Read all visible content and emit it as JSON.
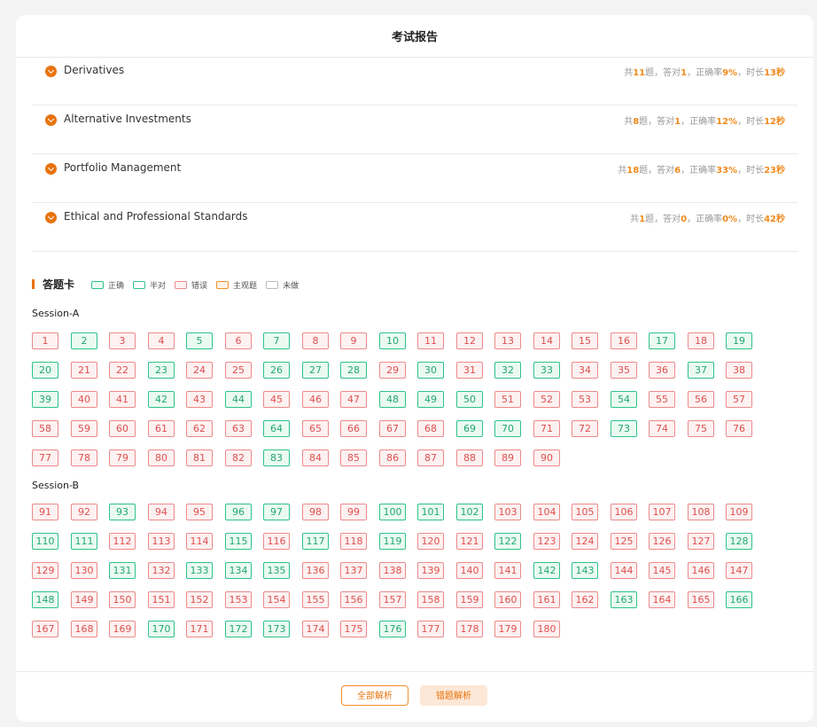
{
  "header": {
    "title": "考试报告"
  },
  "topics": [
    {
      "name": "Derivatives",
      "total": "11",
      "correct": "1",
      "rate": "9%",
      "duration": "13秒"
    },
    {
      "name": "Alternative Investments",
      "total": "8",
      "correct": "1",
      "rate": "12%",
      "duration": "12秒"
    },
    {
      "name": "Portfolio Management",
      "total": "18",
      "correct": "6",
      "rate": "33%",
      "duration": "23秒"
    },
    {
      "name": "Ethical and Professional Standards",
      "total": "1",
      "correct": "0",
      "rate": "0%",
      "duration": "42秒"
    }
  ],
  "stat_labels": {
    "total_prefix": "共",
    "total_suffix": "题，答对",
    "rate_prefix": "，正确率",
    "duration_prefix": "，时长"
  },
  "answer_card": {
    "title": "答题卡",
    "legend": [
      {
        "label": "正确",
        "border": "#2fc28a",
        "fill": "#eafaf3"
      },
      {
        "label": "半对",
        "border": "#2fc28a",
        "fill": "#ffffff"
      },
      {
        "label": "错误",
        "border": "#ec8a8a",
        "fill": "#fdf1f1"
      },
      {
        "label": "主观题",
        "border": "#f0902a",
        "fill": "#fff3e6"
      },
      {
        "label": "未做",
        "border": "#bbbbbb",
        "fill": "#ffffff"
      }
    ]
  },
  "sessions": [
    {
      "name": "Session-A",
      "start": 1,
      "end": 90,
      "correct": [
        2,
        5,
        7,
        10,
        17,
        19,
        20,
        23,
        26,
        27,
        28,
        30,
        32,
        33,
        37,
        39,
        42,
        44,
        48,
        49,
        50,
        54,
        64,
        69,
        70,
        73,
        83
      ]
    },
    {
      "name": "Session-B",
      "start": 91,
      "end": 180,
      "correct": [
        93,
        96,
        97,
        100,
        101,
        102,
        110,
        111,
        115,
        117,
        119,
        122,
        128,
        131,
        133,
        134,
        135,
        142,
        143,
        148,
        163,
        166,
        170,
        172,
        173,
        176
      ]
    }
  ],
  "footer": {
    "all_label": "全部解析",
    "wrong_label": "错题解析"
  },
  "colors": {
    "accent": "#e8730e",
    "highlight": "#f08a1c",
    "correct": "#2fc28a",
    "wrong": "#ec8a8a"
  }
}
